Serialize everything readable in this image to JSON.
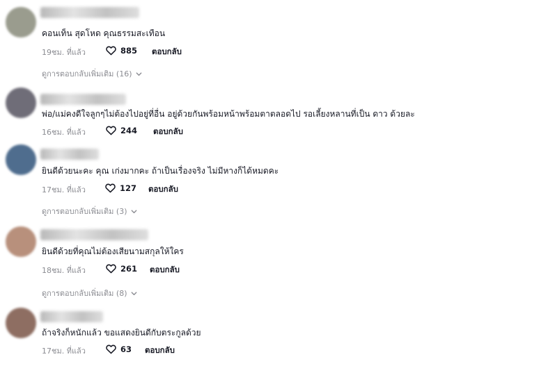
{
  "comments": [
    {
      "text": "คอนเท็น สุดโหด คุณธรรมสะเทือน",
      "time": "19ชม. ที่แล้ว",
      "likes": "885",
      "reply_label": "ตอบกลับ",
      "more_replies": "ดูการตอบกลับเพิ่มเติม (16)",
      "avatar_color": "#9a9c8e"
    },
    {
      "text": "พ่อ/แม่คงดีใจลูกๆไม่ต้องไปอยู่ที่อื่น อยู่ด้วยกันพร้อมหน้าพร้อมตาตลอดไป รอเลี้ยงหลานที่เป็น ดาว ด้วยละ",
      "time": "16ชม. ที่แล้ว",
      "likes": "244",
      "reply_label": "ตอบกลับ",
      "avatar_color": "#6f6d78"
    },
    {
      "text": "ยินดีด้วยนะคะ คุณ เก่งมากคะ ถ้าเป็นเรื่องจริง ไม่มีหางก็ได้หมดคะ",
      "time": "17ชม. ที่แล้ว",
      "likes": "127",
      "reply_label": "ตอบกลับ",
      "more_replies": "ดูการตอบกลับเพิ่มเติม (3)",
      "avatar_color": "#4f6d8e"
    },
    {
      "text": "ยินดีด้วยที่คุณไม่ต้องเสียนามสกุลให้ใคร",
      "time": "18ชม. ที่แล้ว",
      "likes": "261",
      "reply_label": "ตอบกลับ",
      "more_replies": "ดูการตอบกลับเพิ่มเติม (8)",
      "avatar_color": "#b8907c"
    },
    {
      "text": "ถ้าจริงก็หนักแล้ว ขอแสดงยินดีกับตระกูลด้วย",
      "time": "17ชม. ที่แล้ว",
      "likes": "63",
      "reply_label": "ตอบกลับ",
      "avatar_color": "#8e6e62"
    }
  ],
  "icons": {
    "like": "heart-outline-icon",
    "expand": "chevron-down-icon"
  }
}
